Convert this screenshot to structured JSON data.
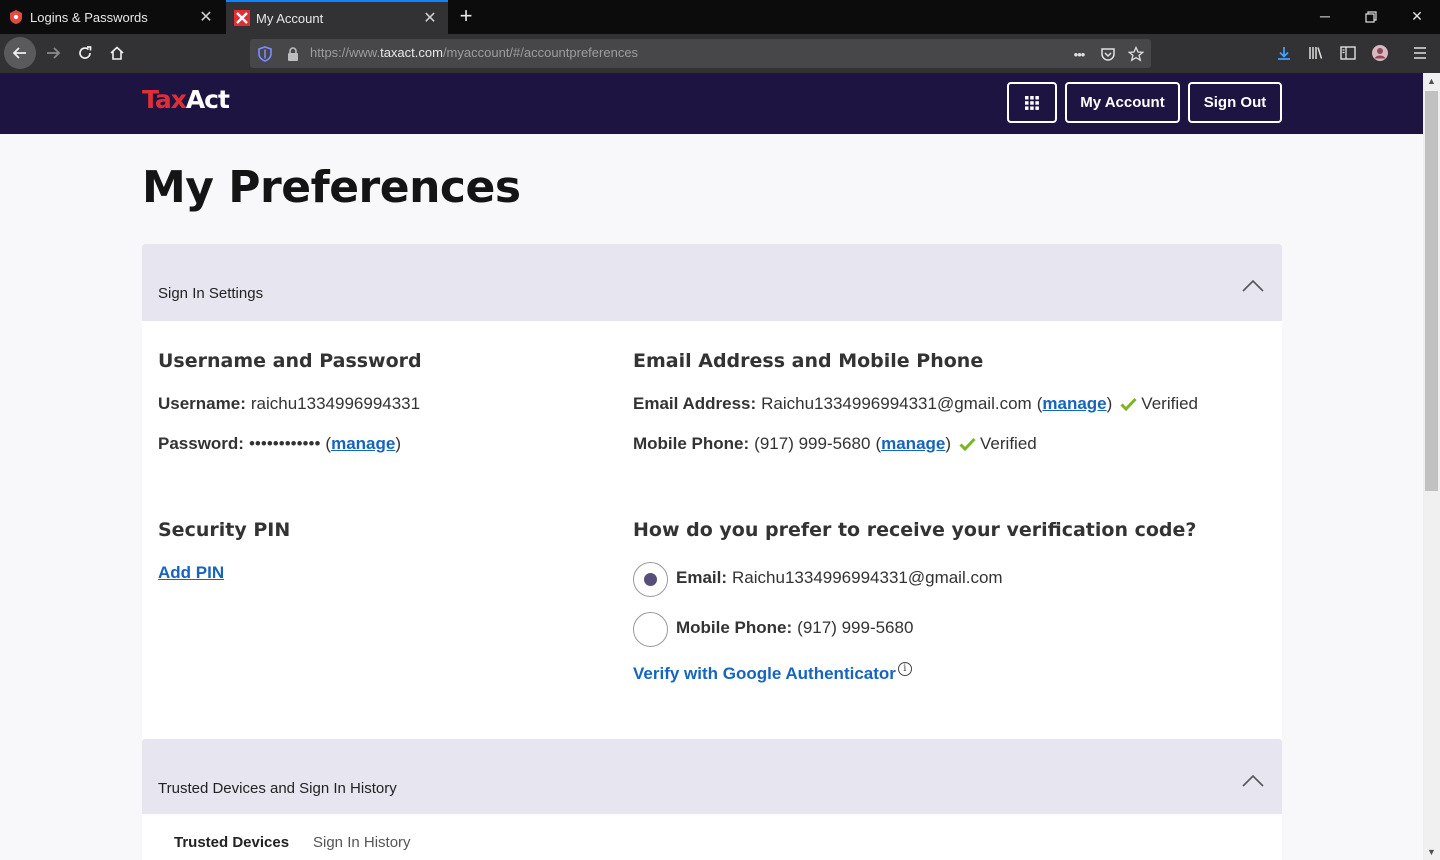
{
  "browser": {
    "tabs": [
      {
        "title": "Logins & Passwords",
        "active": false
      },
      {
        "title": "My Account",
        "active": true
      }
    ],
    "url": {
      "prefix": "https://www.",
      "domain": "taxact.com",
      "path": "/myaccount/#/accountpreferences"
    },
    "url_menu_glyph": "•••"
  },
  "site": {
    "logo": {
      "tax": "Tax",
      "act": "Act"
    },
    "header_buttons": {
      "my_account": "My Account",
      "sign_out": "Sign Out"
    }
  },
  "page": {
    "title": "My Preferences",
    "sign_in_settings": {
      "heading": "Sign In Settings",
      "username_password": {
        "heading": "Username and Password",
        "username_label": "Username:",
        "username_value": "raichu1334996994331",
        "password_label": "Password:",
        "password_mask": "••••••••••••",
        "manage": "manage"
      },
      "email_phone": {
        "heading": "Email Address and Mobile Phone",
        "email_label": "Email Address:",
        "email_value": "Raichu1334996994331@gmail.com",
        "phone_label": "Mobile Phone:",
        "phone_value": "(917) 999-5680",
        "manage": "manage",
        "verified": "Verified"
      },
      "security_pin": {
        "heading": "Security PIN",
        "add_pin": "Add PIN"
      },
      "verification": {
        "heading": "How do you prefer to receive your verification code?",
        "options": [
          {
            "label": "Email:",
            "value": "Raichu1334996994331@gmail.com",
            "selected": true
          },
          {
            "label": "Mobile Phone:",
            "value": "(917) 999-5680",
            "selected": false
          }
        ],
        "google_auth": "Verify with Google Authenticator",
        "info_glyph": "i"
      }
    },
    "trusted_devices": {
      "heading": "Trusted Devices and Sign In History",
      "tabs": [
        "Trusted Devices",
        "Sign In History"
      ]
    }
  },
  "colors": {
    "header_bg": "#1d1441",
    "brand_red": "#e02e36",
    "link": "#1565c0",
    "verified_check": "#7bb61f",
    "panel_head": "#e7e6f0"
  }
}
